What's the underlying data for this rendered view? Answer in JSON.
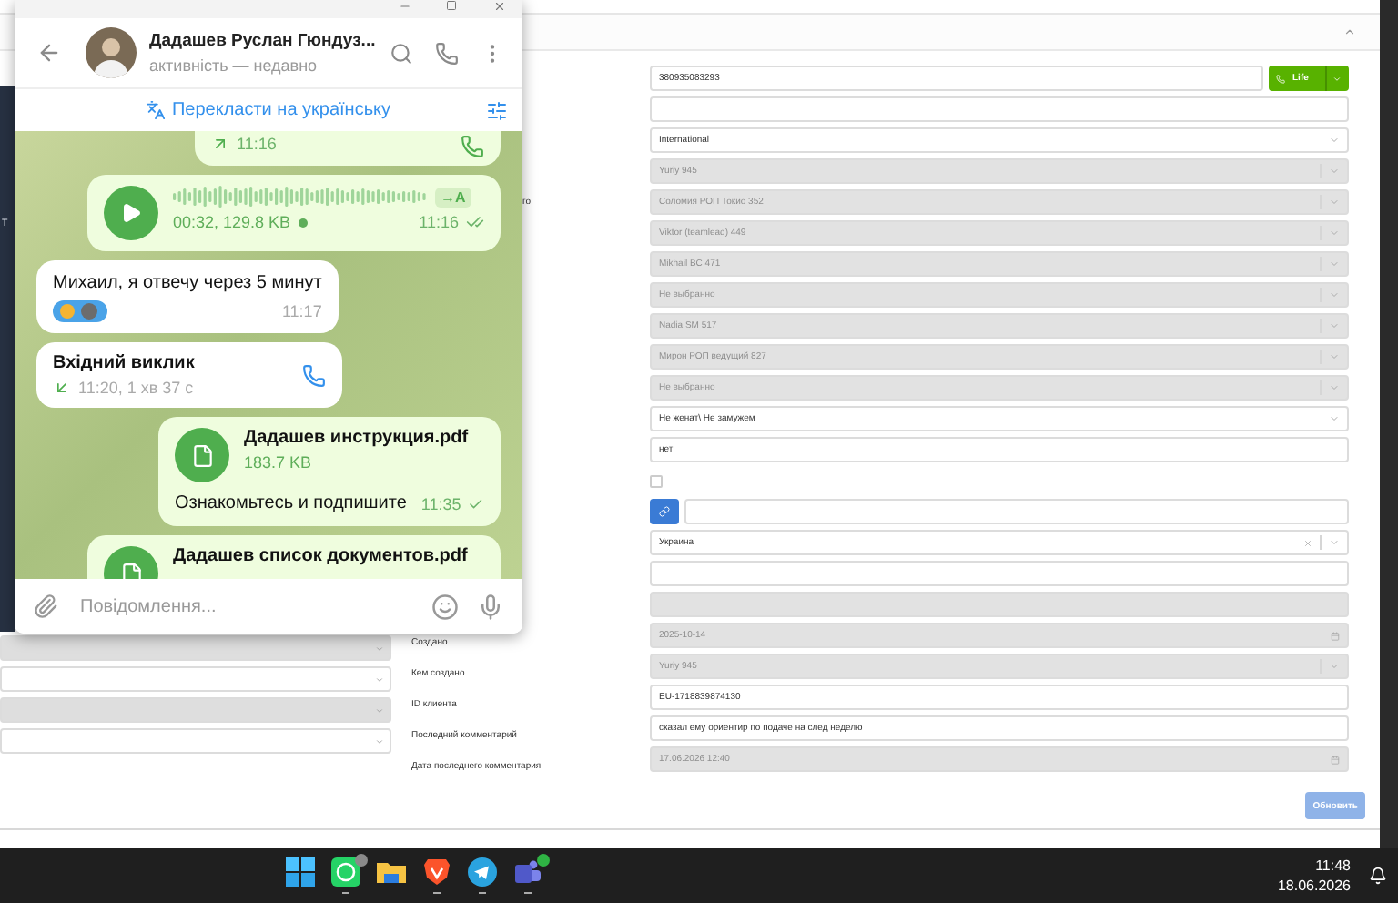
{
  "page": {
    "header": {
      "expanded": true
    },
    "sidebar_fragment": "т",
    "left_selects": [
      {
        "disabled": true
      },
      {
        "disabled": false
      },
      {
        "disabled": true
      },
      {
        "disabled": false
      }
    ],
    "form": {
      "rows": [
        {
          "kind": "phone",
          "value": "380935083293",
          "button": "Life",
          "disabled": false
        },
        {
          "kind": "input",
          "disabled": false
        },
        {
          "kind": "select",
          "value": "International",
          "disabled": false,
          "clearable": false
        },
        {
          "kind": "select",
          "value": "Yuriy 945",
          "disabled": true,
          "clearable": false
        },
        {
          "kind": "select",
          "value": "Соломия РОП Токио 352",
          "disabled": true,
          "clearable": false,
          "label": "го",
          "label_partly_hidden": true
        },
        {
          "kind": "select",
          "value": "Viktor (teamlead) 449",
          "disabled": true,
          "clearable": false
        },
        {
          "kind": "select",
          "value": "Mikhail BC 471",
          "disabled": true,
          "clearable": false
        },
        {
          "kind": "select",
          "value": "Не выбранно",
          "disabled": true,
          "clearable": false
        },
        {
          "kind": "select",
          "value": "Nadia SM 517",
          "disabled": true,
          "clearable": false
        },
        {
          "kind": "select",
          "value": "Мирон РОП ведущий 827",
          "disabled": true,
          "clearable": false
        },
        {
          "kind": "select",
          "value": "Не выбранно",
          "disabled": true,
          "clearable": false
        },
        {
          "kind": "select",
          "value": "Не женат\\ Не замужем",
          "disabled": false,
          "clearable": false
        },
        {
          "kind": "input",
          "value": "нет",
          "disabled": false
        },
        {
          "kind": "checkbox",
          "checked": false
        },
        {
          "kind": "link",
          "disabled": false
        },
        {
          "kind": "select",
          "value": "Украина",
          "disabled": false,
          "clearable": true
        },
        {
          "kind": "input",
          "disabled": false
        },
        {
          "kind": "input",
          "disabled": true
        },
        {
          "kind": "date",
          "value": "2025-10-14",
          "disabled": true,
          "label": "Создано"
        },
        {
          "kind": "select",
          "value": "Yuriy 945",
          "disabled": true,
          "clearable": false,
          "label": "Кем создано"
        },
        {
          "kind": "input",
          "value": "EU-1718839874130",
          "disabled": false,
          "label": "ID клиента"
        },
        {
          "kind": "input",
          "value": "сказал ему ориентир по подаче на след неделю",
          "disabled": false,
          "label": "Последний комментарий"
        },
        {
          "kind": "date",
          "value": "17.06.2026 12:40",
          "disabled": true,
          "label": "Дата последнего комментария"
        }
      ],
      "update_button": "Обновить"
    }
  },
  "telegram": {
    "contact": {
      "name": "Дадашев Руслан Гюндуз...",
      "status": "активність — недавно"
    },
    "translate_bar": {
      "label": "Перекласти на українську"
    },
    "messages": [
      {
        "kind": "call",
        "outgoing": true,
        "time": "11:16"
      },
      {
        "kind": "voice",
        "outgoing": true,
        "meta": "00:32, 129.8 KB",
        "transcribe_label": "→A",
        "listened": false,
        "time": "11:16",
        "read": true
      },
      {
        "kind": "text",
        "outgoing": false,
        "text": "Михаил, я отвечу через 5 минут",
        "has_reactions": true,
        "time": "11:17"
      },
      {
        "kind": "call",
        "outgoing": false,
        "title": "Вхідний виклик",
        "time": "11:20, 1 хв 37 с"
      },
      {
        "kind": "file",
        "outgoing": true,
        "filename": "Дадашев инструкция.pdf",
        "size": "183.7 KB",
        "caption": "Ознакомьтесь и подпишите",
        "time": "11:35",
        "read": false
      },
      {
        "kind": "file",
        "outgoing": true,
        "filename": "Дадашев список документов.pdf"
      }
    ],
    "composer": {
      "placeholder": "Повідомлення..."
    }
  },
  "taskbar": {
    "apps": [
      {
        "kind": "start",
        "running": false
      },
      {
        "kind": "chat",
        "running": true,
        "badge": {
          "color": "#8a8a8a"
        }
      },
      {
        "kind": "files",
        "running": false
      },
      {
        "kind": "browser",
        "running": true
      },
      {
        "kind": "messenger",
        "running": true
      },
      {
        "kind": "meetings",
        "running": true,
        "badge": {
          "color": "#2fb344"
        }
      }
    ],
    "time": "11:48",
    "date": "18.06.2026"
  }
}
